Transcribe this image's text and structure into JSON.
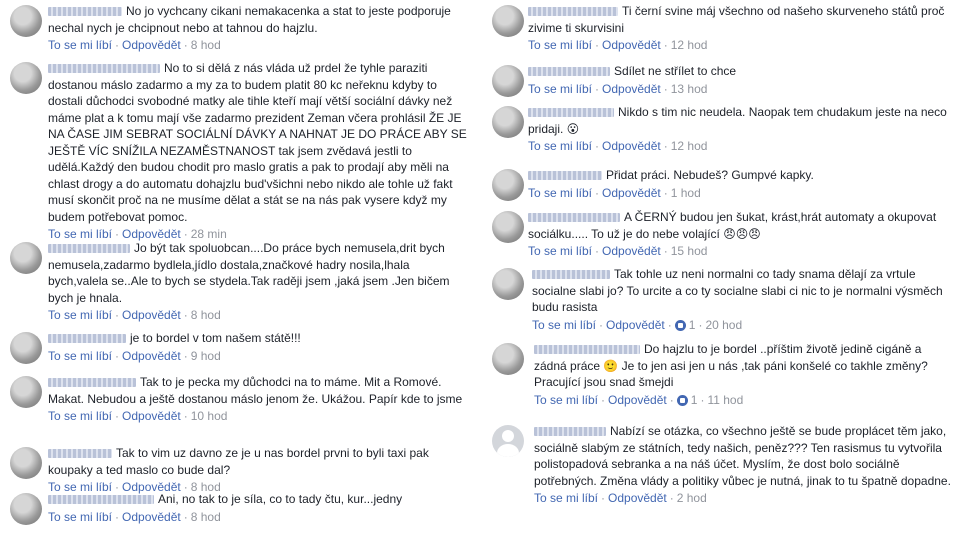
{
  "labels": {
    "like": "To se mi líbí",
    "reply": "Odpovědět",
    "sep": "·"
  },
  "left": [
    {
      "author": "Pavel Vrabec",
      "text": "No jo vychcany cikani nemakacenka a stat to jeste podporuje nechal nych je chcipnout nebo at tahnou do hajzlu.",
      "time": "8 hod"
    },
    {
      "author": "Vlasta Vydrová Bouzková",
      "text": "No to si dělá z nás vláda už prdel že tyhle paraziti dostanou máslo zadarmo a my za to budem platit 80 kc neřeknu kdyby to dostali důchodci svobodné matky ale tihle kteří mají větší sociální dávky než máme plat a k tomu mají vše zadarmo prezident Zeman včera prohlásil ŽE JE NA ČASE JIM SEBRAT SOCIÁLNÍ DÁVKY A NAHNAT JE DO PRÁCE ABY SE JEŠTĚ VÍC SNÍŽILA NEZAMĚSTNANOST tak jsem zvědavá jestli to udělá.Každý den budou chodit pro maslo gratis a pak to prodají aby měli na chlast drogy a do automatu dohajzlu bud'všichni nebo nikdo ale tohle už fakt musí skončit proč na ne musíme dělat a stát se na nás pak vysere když my budem potřebovat pomoc.",
      "time": "28 min"
    },
    {
      "author": "Marie Nováková",
      "text": "Jo být tak spoluobcan....Do práce bych nemusela,drit bych nemusela,zadarmo bydlela,jídlo dostala,značkové hadry nosila,lhala bych,valela se..Ale to bych se stydela.Tak raději jsem ,jaká jsem .Jen bičem bych je hnala.",
      "time": "8 hod"
    },
    {
      "author": "Lenka Suchanová",
      "text": "je to bordel v tom našem státě!!!",
      "time": "9 hod"
    },
    {
      "author": "Marie Skrabalová",
      "text": "Tak to je pecka my důchodci na to máme. Mit a Romové. Makat. Nebudou a ještě dostanou máslo jenom že. Ukážou. Papír kde to jsme",
      "time": "10 hod"
    },
    {
      "author": "Renata Lukáš",
      "text": "Tak to vim uz davno ze je u nas bordel prvni to byli taxi pak koupaky a ted maslo co bude dal?",
      "time": "8 hod"
    },
    {
      "author": "Zuzana Procházková",
      "text": "Ani, no tak to je síla, co to tady čtu, kur...jedny",
      "time": "8 hod"
    }
  ],
  "right": [
    {
      "author": "Vladimír Šťastný",
      "text": "Ti černí svine máj všechno od našeho skurveneho států proč zivime ti skurvisini",
      "time": "12 hod"
    },
    {
      "author": "Václav Bouček",
      "text": "Sdílet ne střílet to chce",
      "time": "13 hod"
    },
    {
      "author": "Jana Šťastná",
      "text": "Nikdo s tim nic neudela. Naopak tem chudakum jeste na neco pridaji. 😮",
      "time": "12 hod"
    },
    {
      "author": "Radek Polák",
      "text": "Přidat práci. Nebudeš? Gumpvé kapky.",
      "time": "1 hod"
    },
    {
      "author": "Zdeněk Drašner",
      "text": "A ČERNÝ budou jen šukat, krást,hrát automaty a okupovat sociálku..... To už je do nebe volající 😠😠😠",
      "time": "15 hod"
    },
    {
      "author": "Josef Sedlák",
      "text": "Tak tohle uz neni normalni co tady snama dělají za vrtule socialne slabi jo? To urcite a co ty socialne slabi ci nic to je normalni výsměch budu rasista",
      "count": "1",
      "time": "20 hod"
    },
    {
      "author": "Dagmar Chaloupková",
      "text": "Do hajzlu to je bordel ..příštim životě jedině cigáně a zádná práce 🙂 Je to jen asi jen u nás ,tak páni konšelé co takhle změny? Pracující jsou snad šmejdi",
      "count": "1",
      "time": "11 hod"
    },
    {
      "author": "Adam Brown",
      "text": "Nabízí se otázka, co všechno ještě se bude proplácet těm jako, sociálně slabým ze státních, tedy našich, peněz??? Ten rasismus tu vytvořila polistopadová sebranka a na náš účet. Myslím, že dost bolo sociálně potřebných. Změna vlády a politiky vůbec je nutná, jinak to tu špatně dopadne.",
      "time": "2 hod"
    }
  ]
}
